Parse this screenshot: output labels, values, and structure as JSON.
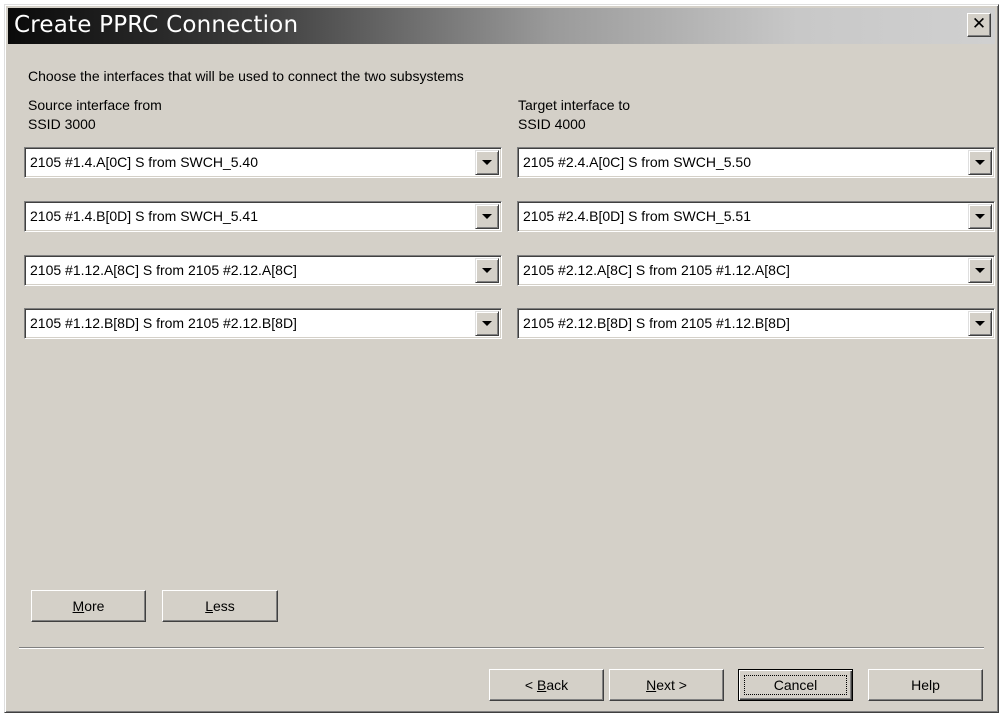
{
  "window": {
    "title": "Create PPRC Connection",
    "close_glyph": "✕"
  },
  "instructions": "Choose the interfaces that will be used to connect the two subsystems",
  "source": {
    "heading_line1": "Source interface from",
    "heading_line2": "SSID 3000",
    "selects": [
      "2105 #1.4.A[0C] S from SWCH_5.40",
      "2105 #1.4.B[0D] S from SWCH_5.41",
      "2105 #1.12.A[8C] S from 2105 #2.12.A[8C]",
      "2105 #1.12.B[8D] S from 2105 #2.12.B[8D]"
    ]
  },
  "target": {
    "heading_line1": "Target interface to",
    "heading_line2": "SSID 4000",
    "selects": [
      "2105 #2.4.A[0C] S from SWCH_5.50",
      "2105 #2.4.B[0D] S from SWCH_5.51",
      "2105 #2.12.A[8C] S from 2105 #1.12.A[8C]",
      "2105 #2.12.B[8D] S from 2105 #1.12.B[8D]"
    ]
  },
  "buttons": {
    "more_mnemonic": "M",
    "more_rest": "ore",
    "less_mnemonic": "L",
    "less_rest": "ess",
    "back_prefix": "< ",
    "back_mnemonic": "B",
    "back_rest": "ack",
    "next_mnemonic": "N",
    "next_rest": "ext >",
    "cancel": "Cancel",
    "help": "Help"
  },
  "icons": {
    "close": "close-icon",
    "dropdown": "chevron-down-icon"
  },
  "colors": {
    "dialog_background": "#d4d0c8",
    "title_gradient_start": "#0a0a0a",
    "title_gradient_end": "#d0d0d0",
    "title_text": "#ffffff"
  }
}
